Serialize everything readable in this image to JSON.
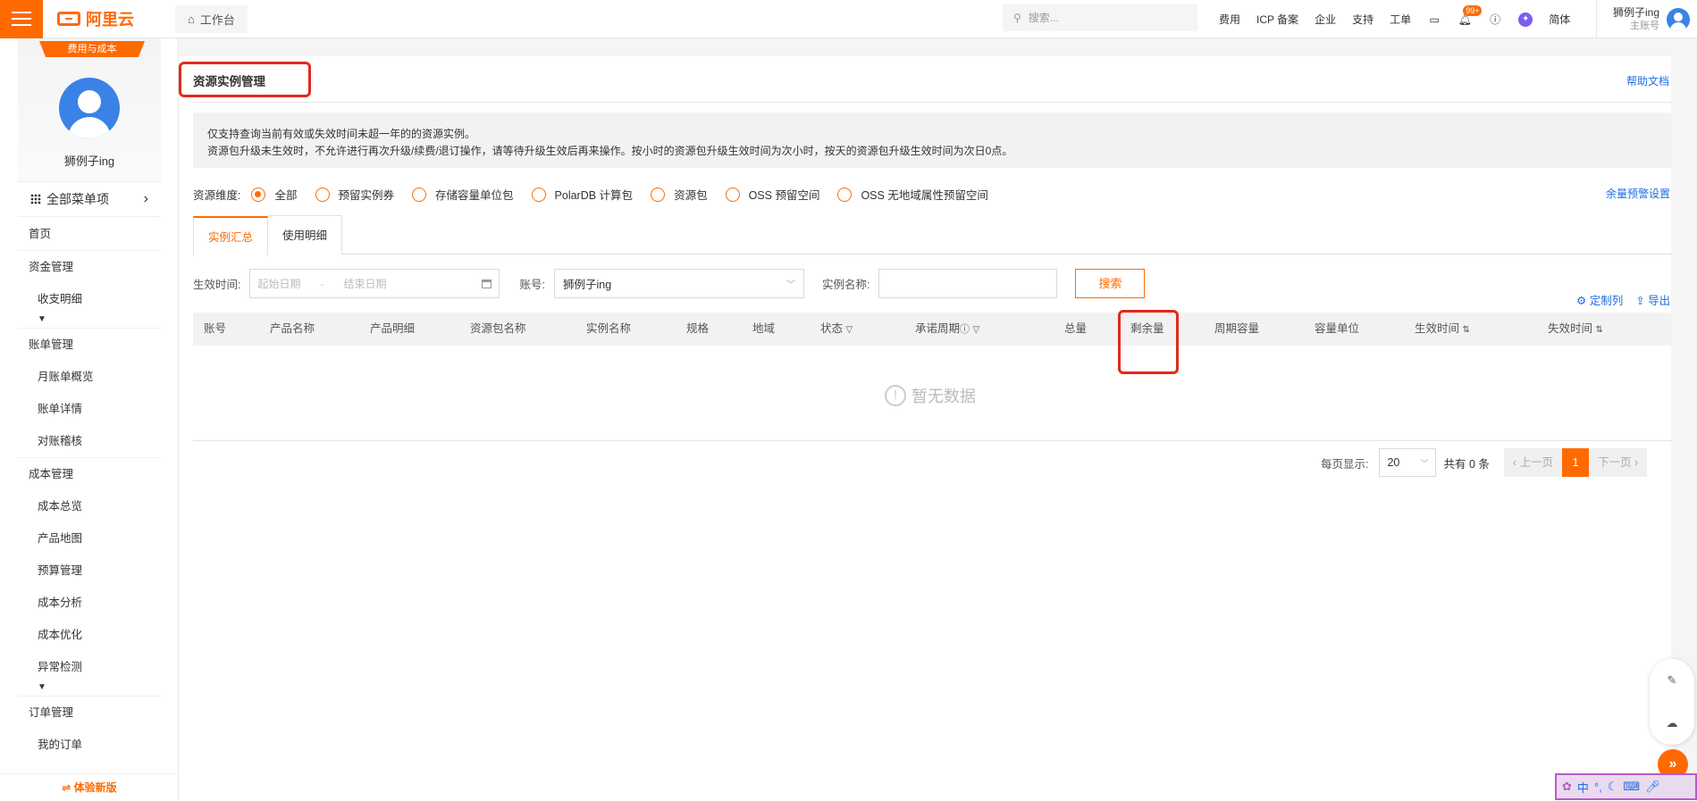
{
  "topbar": {
    "workbench": "工作台",
    "search_placeholder": "搜索...",
    "links": [
      "费用",
      "ICP 备案",
      "企业",
      "支持",
      "工单"
    ],
    "badge": "99+",
    "lang": "简体",
    "user_name": "狮例子ing",
    "user_role": "主账号"
  },
  "sidebar": {
    "tag": "费用与成本",
    "profile_name": "狮例子ing",
    "all_menu": "全部菜单项",
    "home": "首页",
    "groups": [
      {
        "title": "资金管理",
        "items": [
          "收支明细"
        ],
        "more": true
      },
      {
        "title": "账单管理",
        "items": [
          "月账单概览",
          "账单详情",
          "对账稽核"
        ],
        "more": false
      },
      {
        "title": "成本管理",
        "items": [
          "成本总览",
          "产品地图",
          "预算管理",
          "成本分析",
          "成本优化",
          "异常检测"
        ],
        "more": true
      },
      {
        "title": "订单管理",
        "items": [
          "我的订单"
        ],
        "more": false
      }
    ],
    "new_version": "⇌ 体验新版"
  },
  "main": {
    "title": "资源实例管理",
    "help": "帮助文档",
    "notice_line1": "仅支持查询当前有效或失效时间未超一年的的资源实例。",
    "notice_line2": "资源包升级未生效时，不允许进行再次升级/续费/退订操作，请等待升级生效后再来操作。按小时的资源包升级生效时间为次小时，按天的资源包升级生效时间为次日0点。",
    "dimension_label": "资源维度:",
    "dimensions": [
      "全部",
      "预留实例券",
      "存储容量单位包",
      "PolarDB 计算包",
      "资源包",
      "OSS 预留空间",
      "OSS 无地域属性预留空间"
    ],
    "alert_settings": "余量预警设置",
    "tabs": [
      "实例汇总",
      "使用明细"
    ],
    "filters": {
      "effective_label": "生效时间:",
      "start_placeholder": "起始日期",
      "end_placeholder": "结束日期",
      "account_label": "账号:",
      "account_value": "狮例子ing",
      "instance_label": "实例名称:",
      "search_button": "搜索"
    },
    "tools": {
      "customize": "定制列",
      "export": "导出"
    },
    "columns": [
      "账号",
      "产品名称",
      "产品明细",
      "资源包名称",
      "实例名称",
      "规格",
      "地域",
      "状态",
      "承诺周期",
      "总量",
      "剩余量",
      "周期容量",
      "容量单位",
      "生效时间",
      "失效时间"
    ],
    "empty_text": "暂无数据",
    "pagination": {
      "page_size_label": "每页显示:",
      "page_size": "20",
      "total": "共有 0 条",
      "prev": "上一页",
      "current": "1",
      "next": "下一页"
    }
  },
  "ime": {
    "labels": [
      "中"
    ]
  }
}
